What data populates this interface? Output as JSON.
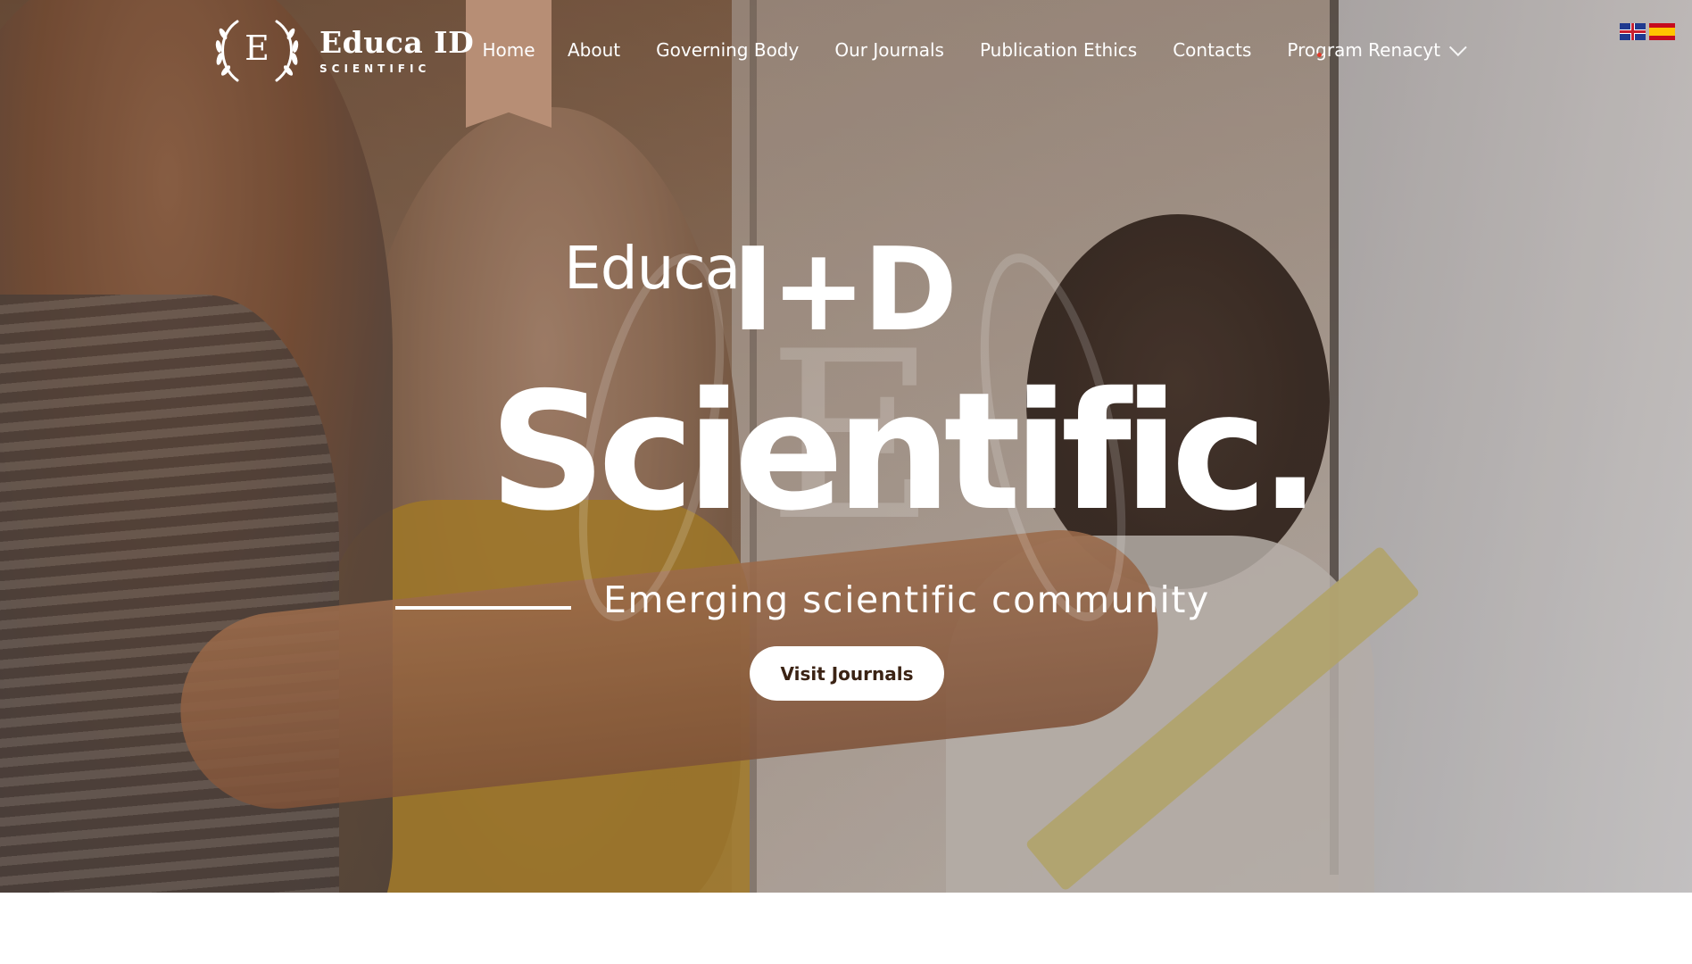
{
  "brand": {
    "logo_letter": "E",
    "title": "Educa ID",
    "subtitle": "SCIENTIFIC"
  },
  "nav": {
    "items": [
      {
        "label": "Home",
        "active": true
      },
      {
        "label": "About"
      },
      {
        "label": "Governing Body"
      },
      {
        "label": "Our Journals"
      },
      {
        "label": "Publication Ethics"
      },
      {
        "label": "Contacts"
      },
      {
        "label": "Program Renacyt",
        "has_dropdown": true,
        "icon": "chevron-down-icon"
      }
    ]
  },
  "languages": [
    {
      "code": "en",
      "icon": "uk-flag-icon"
    },
    {
      "code": "es",
      "icon": "spain-flag-icon"
    }
  ],
  "hero": {
    "line1_small": "Educa",
    "line1_large": "I+D",
    "line2": "Scientific.",
    "tagline": "Emerging scientific community",
    "cta_label": "Visit Journals"
  },
  "colors": {
    "accent_ribbon": "#b78e75",
    "cta_text": "#3b2314"
  }
}
